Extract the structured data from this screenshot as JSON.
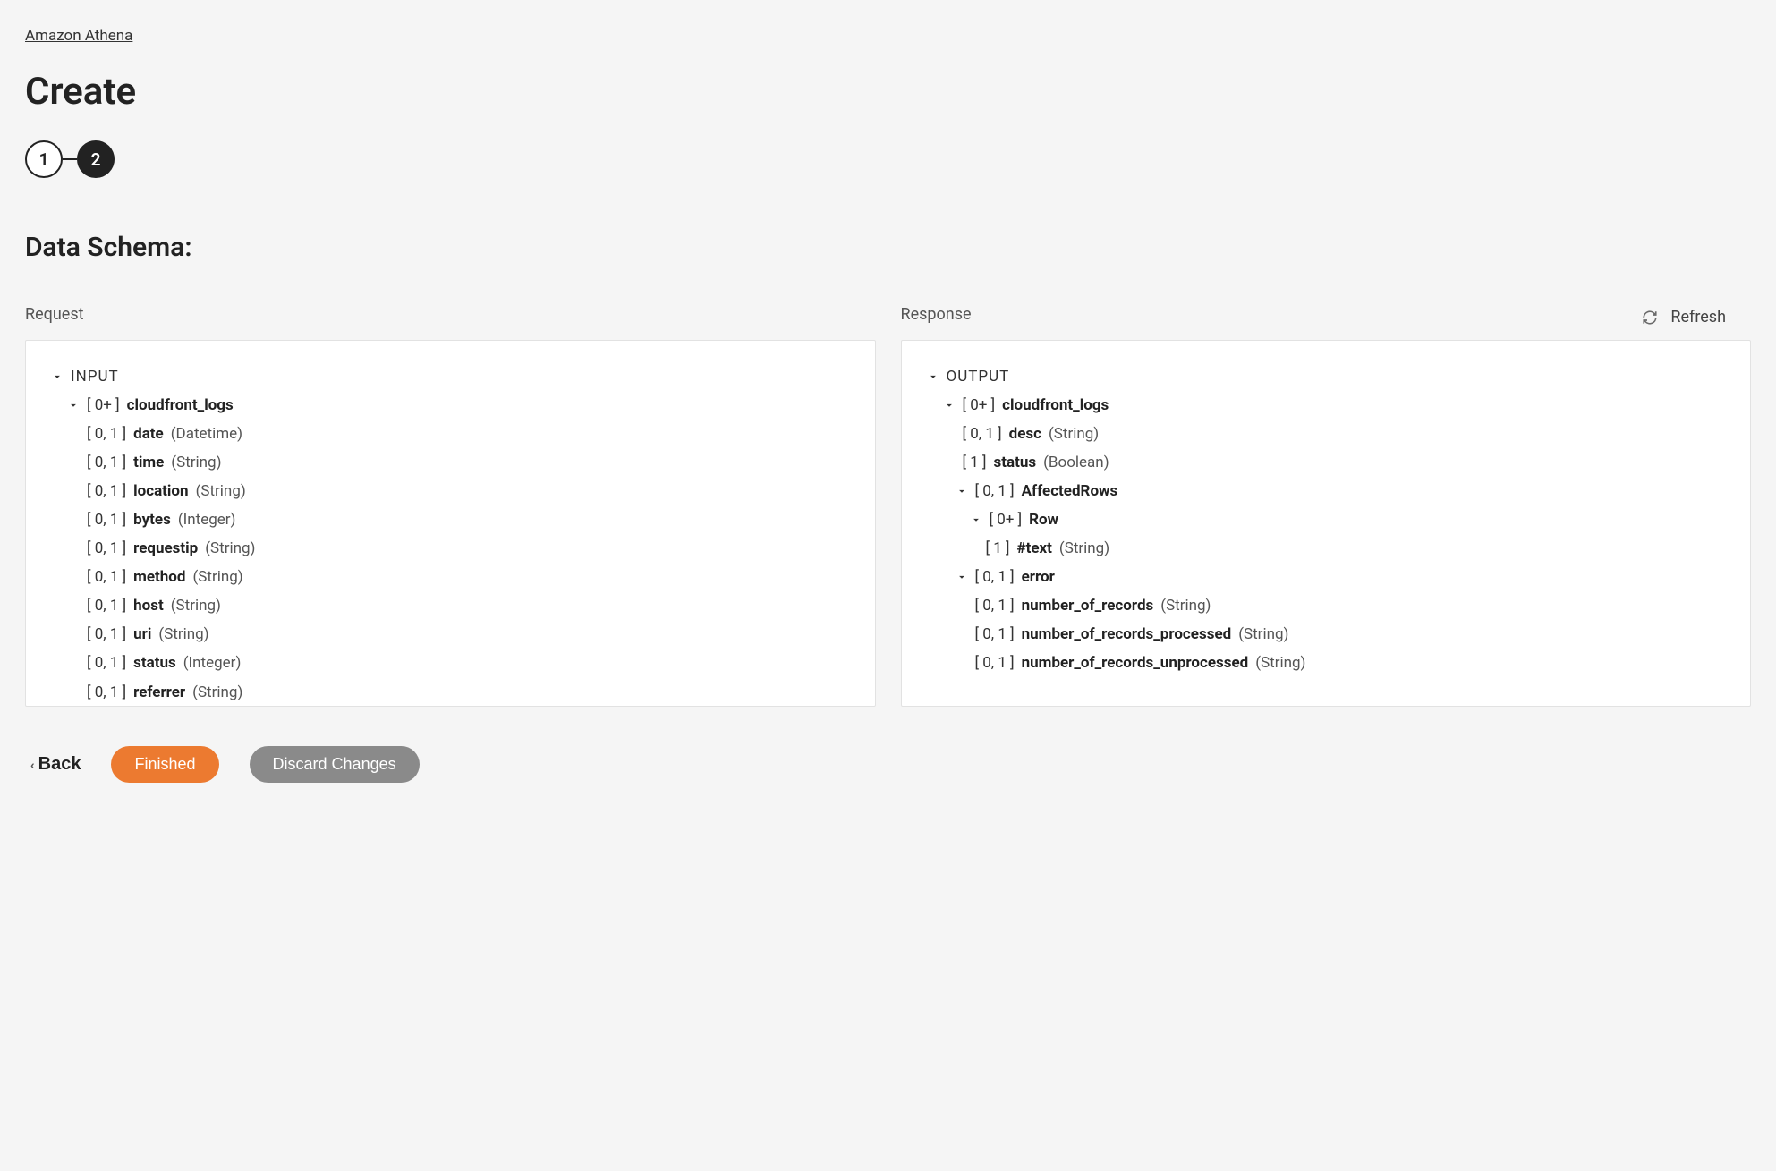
{
  "breadcrumb": "Amazon Athena",
  "page_title": "Create",
  "stepper": {
    "step1": "1",
    "step2": "2"
  },
  "section_title": "Data Schema:",
  "refresh_label": "Refresh",
  "request": {
    "label": "Request",
    "root": "INPUT",
    "group_card": "[ 0+ ]",
    "group_name": "cloudfront_logs",
    "fields": [
      {
        "card": "[ 0, 1 ]",
        "name": "date",
        "type": "(Datetime)"
      },
      {
        "card": "[ 0, 1 ]",
        "name": "time",
        "type": "(String)"
      },
      {
        "card": "[ 0, 1 ]",
        "name": "location",
        "type": "(String)"
      },
      {
        "card": "[ 0, 1 ]",
        "name": "bytes",
        "type": "(Integer)"
      },
      {
        "card": "[ 0, 1 ]",
        "name": "requestip",
        "type": "(String)"
      },
      {
        "card": "[ 0, 1 ]",
        "name": "method",
        "type": "(String)"
      },
      {
        "card": "[ 0, 1 ]",
        "name": "host",
        "type": "(String)"
      },
      {
        "card": "[ 0, 1 ]",
        "name": "uri",
        "type": "(String)"
      },
      {
        "card": "[ 0, 1 ]",
        "name": "status",
        "type": "(Integer)"
      },
      {
        "card": "[ 0, 1 ]",
        "name": "referrer",
        "type": "(String)"
      }
    ]
  },
  "response": {
    "label": "Response",
    "root": "OUTPUT",
    "group_card": "[ 0+ ]",
    "group_name": "cloudfront_logs",
    "desc": {
      "card": "[ 0, 1 ]",
      "name": "desc",
      "type": "(String)"
    },
    "status": {
      "card": "[ 1 ]",
      "name": "status",
      "type": "(Boolean)"
    },
    "affected": {
      "card": "[ 0, 1 ]",
      "name": "AffectedRows"
    },
    "row": {
      "card": "[ 0+ ]",
      "name": "Row"
    },
    "text": {
      "card": "[ 1 ]",
      "name": "#text",
      "type": "(String)"
    },
    "error": {
      "card": "[ 0, 1 ]",
      "name": "error"
    },
    "error_fields": [
      {
        "card": "[ 0, 1 ]",
        "name": "number_of_records",
        "type": "(String)"
      },
      {
        "card": "[ 0, 1 ]",
        "name": "number_of_records_processed",
        "type": "(String)"
      },
      {
        "card": "[ 0, 1 ]",
        "name": "number_of_records_unprocessed",
        "type": "(String)"
      }
    ]
  },
  "footer": {
    "back": "Back",
    "finished": "Finished",
    "discard": "Discard Changes"
  }
}
